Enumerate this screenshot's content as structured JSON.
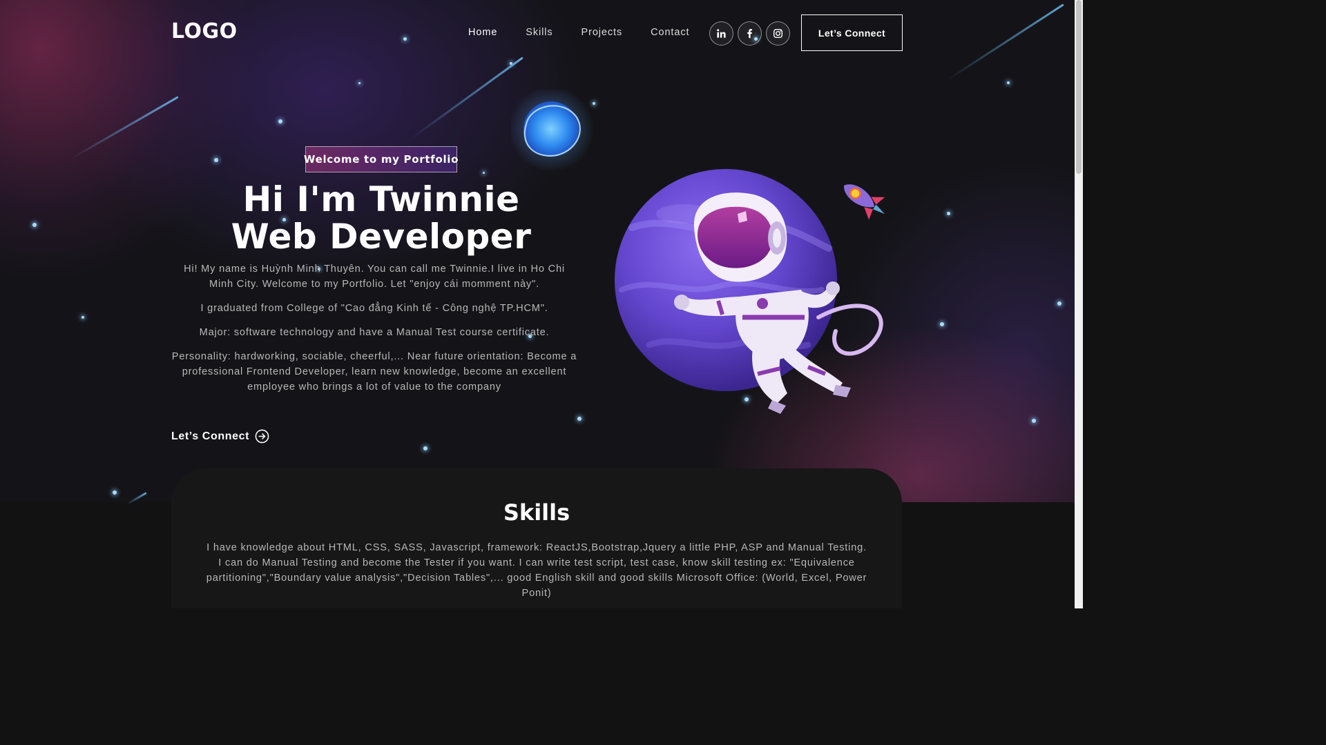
{
  "navbar": {
    "logo": "LOGO",
    "links": [
      {
        "label": "Home",
        "active": true
      },
      {
        "label": "Skills",
        "active": false
      },
      {
        "label": "Projects",
        "active": false
      },
      {
        "label": "Contact",
        "active": false
      }
    ],
    "social_icons": [
      "linkedin-icon",
      "facebook-icon",
      "instagram-icon"
    ],
    "connect_button": "Let’s Connect"
  },
  "hero": {
    "tagline": "Welcome to my Portfolio",
    "title_line1": "Hi I'm Twinnie",
    "title_line2": "Web Developer",
    "paragraphs": [
      "Hi! My name is Huỳnh Minh Thuyên. You can call me Twinnie.I live in Ho Chi Minh City. Welcome to my Portfolio. Let \"enjoy cái momment này\".",
      "I graduated from College of \"Cao đẳng Kinh tế - Công nghệ TP.HCM\".",
      "Major: software technology and have a Manual Test course certificate.",
      "Personality: hardworking, sociable, cheerful,... Near future orientation: Become a professional Frontend Developer, learn new knowledge, become an excellent employee who brings a lot of value to the company"
    ],
    "cta": "Let’s Connect",
    "cta_icon": "arrow-circle-right-icon",
    "illustration": "astronaut-planet-illustration"
  },
  "skills": {
    "title": "Skills",
    "description": "I have knowledge about HTML, CSS, SASS, Javascript, framework: ReactJS,Bootstrap,Jquery a little PHP, ASP and Manual Testing. I can do Manual Testing and become the Tester if you want. I can write test script, test case, know skill testing ex: \"Equivalence partitioning\",\"Boundary value analysis\",\"Decision Tables\",... good English skill and good skills Microsoft Office: (World, Excel, Power Ponit)"
  },
  "colors": {
    "background": "#121212",
    "tagline_gradient_start": "#AA367C",
    "tagline_gradient_end": "#4A2FBD",
    "planet": "#6a4fd6",
    "star": "#a9dcf5"
  }
}
